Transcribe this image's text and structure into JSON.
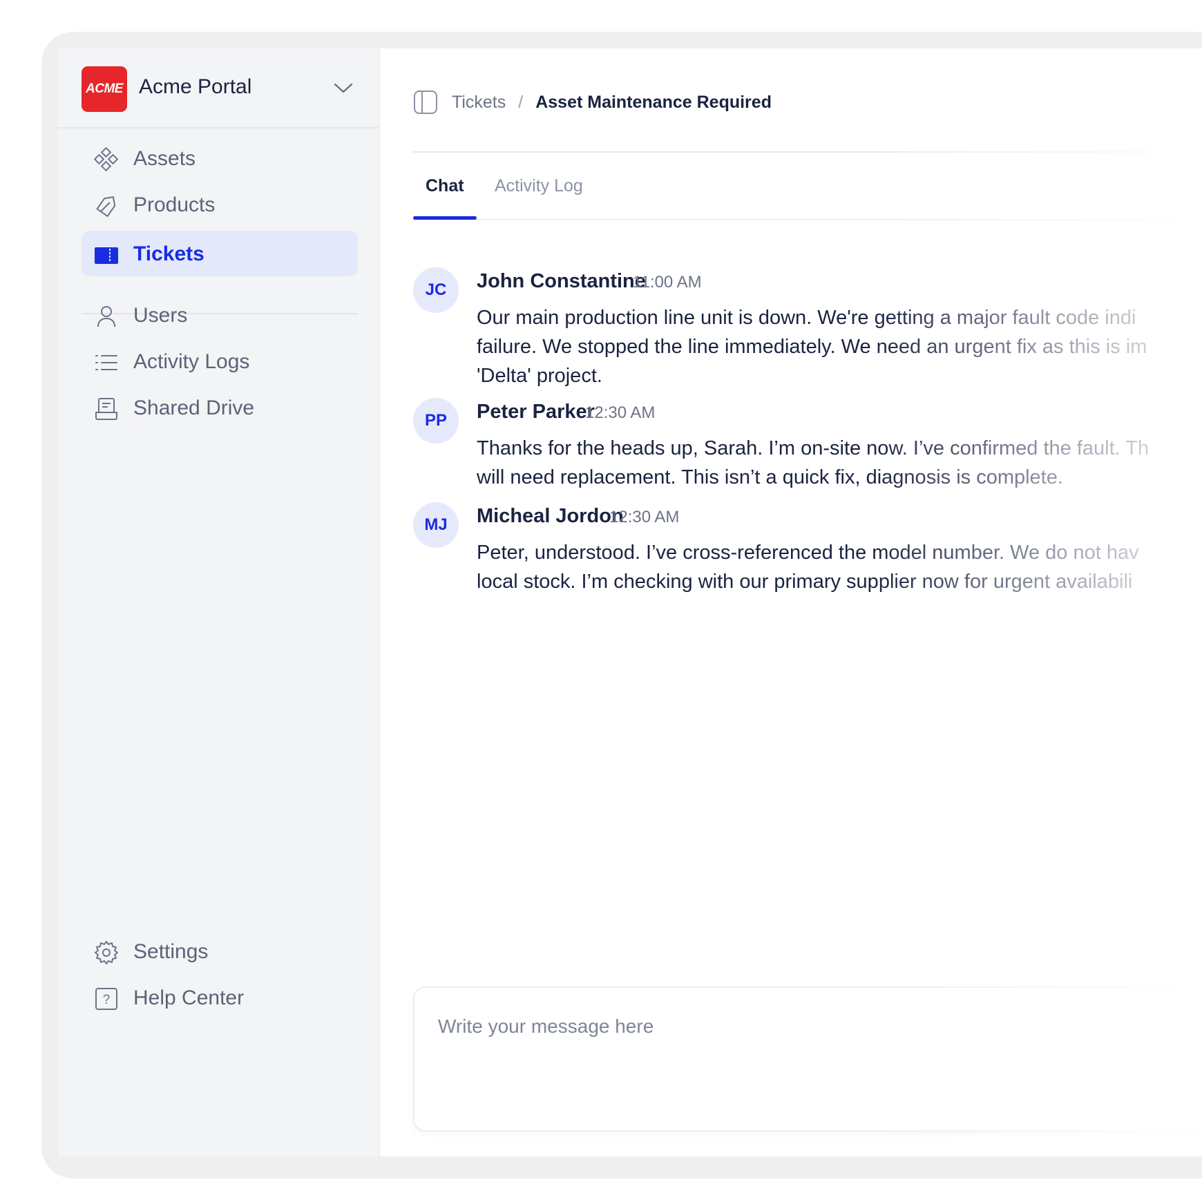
{
  "brand": {
    "logo_text": "ACME",
    "name": "Acme Portal"
  },
  "sidebar": {
    "items": [
      {
        "label": "Assets",
        "icon": "assets-icon"
      },
      {
        "label": "Products",
        "icon": "tag-icon"
      },
      {
        "label": "Tickets",
        "icon": "ticket-icon",
        "active": true
      },
      {
        "label": "Users",
        "icon": "user-icon"
      },
      {
        "label": "Activity Logs",
        "icon": "list-icon"
      },
      {
        "label": "Shared Drive",
        "icon": "drive-icon"
      }
    ],
    "footer_items": [
      {
        "label": "Settings",
        "icon": "gear-icon"
      },
      {
        "label": "Help Center",
        "icon": "help-icon"
      }
    ]
  },
  "breadcrumb": {
    "root": "Tickets",
    "separator": "/",
    "current": "Asset Maintenance Required"
  },
  "tabs": [
    {
      "label": "Chat",
      "active": true
    },
    {
      "label": "Activity Log",
      "active": false
    }
  ],
  "messages": [
    {
      "initials": "JC",
      "author": "John Constantine",
      "time": "11:00 AM",
      "text": "Our main production line unit is down. We're getting a major fault code indi failure. We stopped the line immediately. We need an urgent fix as this is im 'Delta' project."
    },
    {
      "initials": "PP",
      "author": "Peter Parker",
      "time": "12:30 AM",
      "text": "Thanks for the heads up, Sarah. I’m on-site now. I’ve confirmed the fault. Th will need replacement. This isn’t a quick fix, diagnosis is complete."
    },
    {
      "initials": "MJ",
      "author": "Micheal Jordon",
      "time": "12:30 AM",
      "text": "Peter, understood. I’ve cross-referenced the model number. We do not hav local stock. I’m checking with our primary supplier now for urgent availabili"
    }
  ],
  "composer": {
    "placeholder": "Write your message here"
  },
  "colors": {
    "accent": "#1a2ce0",
    "brand": "#e5262b",
    "active_bg": "#e3e8fb"
  }
}
